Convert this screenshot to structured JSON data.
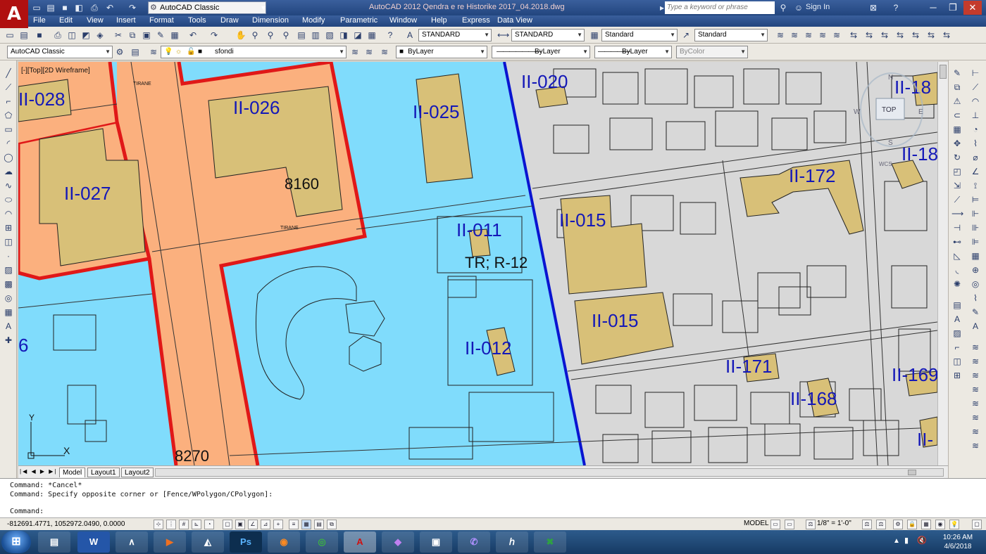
{
  "app": {
    "logo_glyph": "A",
    "workspace": "AutoCAD Classic",
    "title": "AutoCAD 2012   Qendra e re Historike 2017_04.2018.dwg",
    "search_placeholder": "Type a keyword or phrase",
    "signin": "Sign In"
  },
  "menu": [
    "File",
    "Edit",
    "View",
    "Insert",
    "Format",
    "Tools",
    "Draw",
    "Dimension",
    "Modify",
    "Parametric",
    "Window",
    "Help",
    "Express",
    "Data View"
  ],
  "toolbar1": {
    "text_style": "STANDARD",
    "dim_style": "STANDARD",
    "table_style": "Standard",
    "mleader_style": "Standard"
  },
  "toolbar2": {
    "workspace": "AutoCAD Classic",
    "layer": "sfondi",
    "color": "ByLayer",
    "linetype": "ByLayer",
    "lineweight": "ByLayer",
    "plotstyle": "ByColor"
  },
  "viewport": {
    "label": "[-][Top][2D Wireframe]",
    "viewcube_top": "TOP",
    "viewcube_n": "N",
    "viewcube_s": "S",
    "viewcube_w": "W",
    "viewcube_e": "E",
    "wcs": "WCS",
    "ucs_x": "X",
    "ucs_y": "Y"
  },
  "drawing_labels": {
    "p028": "II-028",
    "p026": "II-026",
    "p025": "II-025",
    "p027": "II-027",
    "p020": "II-020",
    "p011": "II-011",
    "p012": "II-012",
    "p015a": "II-015",
    "p015b": "II-015",
    "p172": "II-172",
    "p171": "II-171",
    "p168": "II-168",
    "p169": "II-169",
    "p18a": "II-18",
    "p18b": "II-18",
    "p_l": "II-",
    "p6": "6",
    "num8160": "8160",
    "num8270": "8270",
    "tr": "TR; R-12",
    "street1": "TIRANE",
    "street2": "TIRANE"
  },
  "tabs": [
    "Model",
    "Layout1",
    "Layout2"
  ],
  "command": {
    "line1": "Command: *Cancel*",
    "line2": "Command: Specify opposite corner or [Fence/WPolygon/CPolygon]:",
    "prompt": "Command:"
  },
  "status": {
    "coords": "-812691.4771, 1052972.0490, 0.0000",
    "model": "MODEL",
    "scale": "1/8\" = 1'-0\""
  },
  "taskbar": {
    "time": "10:26 AM",
    "date": "4/6/2018",
    "apps": [
      "W",
      "Ps"
    ]
  },
  "colors": {
    "blue_zone": "#80dcfc",
    "orange_zone": "#fbb07e",
    "building": "#d8c078",
    "red_border": "#e01818",
    "blue_line": "#0a14d0",
    "label_blue": "#1418b8"
  }
}
